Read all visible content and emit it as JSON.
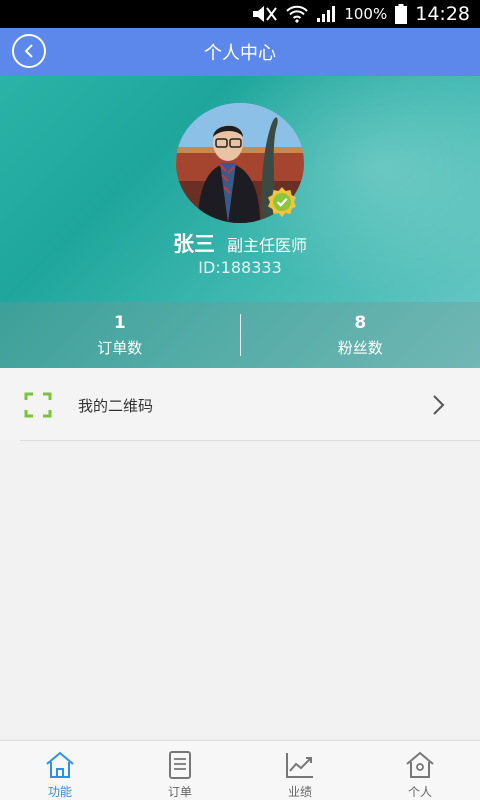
{
  "status_bar": {
    "battery": "100%",
    "time": "14:28"
  },
  "header": {
    "title": "个人中心"
  },
  "profile": {
    "name": "张三",
    "title": "副主任医师",
    "id": "ID:188333"
  },
  "stats": [
    {
      "value": "1",
      "label": "订单数"
    },
    {
      "value": "8",
      "label": "粉丝数"
    }
  ],
  "menu": [
    {
      "label": "我的二维码",
      "icon": "qr-scan-icon"
    }
  ],
  "bottom_nav": [
    {
      "label": "功能",
      "icon": "home-icon",
      "active": true
    },
    {
      "label": "订单",
      "icon": "order-document-icon",
      "active": false
    },
    {
      "label": "业绩",
      "icon": "trend-chart-icon",
      "active": false
    },
    {
      "label": "个人",
      "icon": "person-home-icon",
      "active": false
    }
  ],
  "colors": {
    "header": "#5b88ea",
    "hero": "#2bb3a8",
    "accent_green": "#7bc43a",
    "nav_active": "#2f8fe6"
  }
}
